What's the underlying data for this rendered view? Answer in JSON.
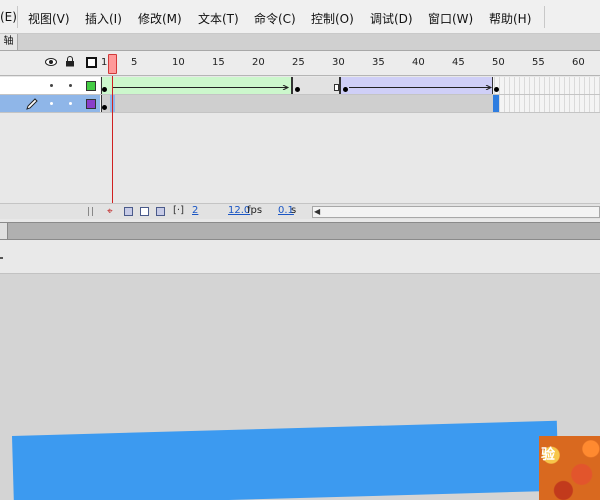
{
  "menubar": {
    "items": [
      {
        "label": "(E)"
      },
      {
        "label": "视图(V)"
      },
      {
        "label": "插入(I)"
      },
      {
        "label": "修改(M)"
      },
      {
        "label": "文本(T)"
      },
      {
        "label": "命令(C)"
      },
      {
        "label": "控制(O)"
      },
      {
        "label": "调试(D)"
      },
      {
        "label": "窗口(W)"
      },
      {
        "label": "帮助(H)"
      }
    ]
  },
  "timeline": {
    "tab_label": "轴",
    "ruler": [
      "1",
      "5",
      "10",
      "15",
      "20",
      "25",
      "30",
      "35",
      "40",
      "45",
      "50",
      "55",
      "60"
    ],
    "current_frame": "2",
    "frame_rate": "12.0",
    "frame_rate_unit": "fps",
    "elapsed_time": "0.1",
    "elapsed_unit": "s",
    "layers": [
      {
        "color": "#44cc44",
        "tween1_color": "#ccf7cc",
        "tween2_color": "#cfcff7"
      },
      {
        "color": "#8a3ec9"
      }
    ]
  },
  "overlay": {
    "photo_text": "验"
  }
}
